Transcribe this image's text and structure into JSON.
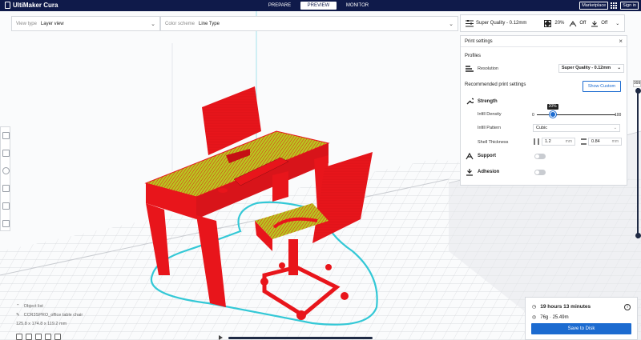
{
  "app": {
    "name": "UltiMaker Cura",
    "stages": [
      "PREPARE",
      "PREVIEW",
      "MONITOR"
    ],
    "active_stage": "PREVIEW",
    "marketplace_label": "Marketplace",
    "signin_label": "Sign in"
  },
  "view_toolbar": {
    "view_type_label": "View type",
    "view_type_value": "Layer view",
    "color_scheme_label": "Color scheme",
    "color_scheme_value": "Line Type",
    "quality": "Super Quality - 0.12mm",
    "infill": "20%",
    "support": "Off",
    "adhesion": "Off"
  },
  "print_settings": {
    "title": "Print settings",
    "profiles_label": "Profiles",
    "resolution_label": "Resolution",
    "resolution_value": "Super Quality - 0.12mm",
    "recommended_label": "Recommended print settings",
    "show_custom_label": "Show Custom",
    "strength_label": "Strength",
    "infill_density_label": "Infill Density",
    "infill_density_tip": "20%",
    "infill_min": "0",
    "infill_max": "100",
    "infill_density_fraction": 0.2,
    "infill_pattern_label": "Infill Pattern",
    "infill_pattern_value": "Cubic",
    "shell_thickness_label": "Shell Thickness",
    "wall_thickness": "1.2",
    "top_bottom_thickness": "0.84",
    "unit_mm": "mm",
    "support_label": "Support",
    "adhesion_label": "Adhesion"
  },
  "layer_slider": {
    "top_value": "999"
  },
  "object_info": {
    "list_label": "Object list",
    "filename": "CCR3SPRO_office table chair",
    "dimensions": "125.8 x 174.8 x 119.2 mm"
  },
  "estimate": {
    "time": "19 hours 13 minutes",
    "material": "76g · 25.49m",
    "save_label": "Save to Disk"
  },
  "colors": {
    "accent": "#1c6bd0",
    "header": "#0f1a4a",
    "model_red": "#e8151b",
    "model_yellow": "#b7c820",
    "skirt": "#33c8d6"
  }
}
